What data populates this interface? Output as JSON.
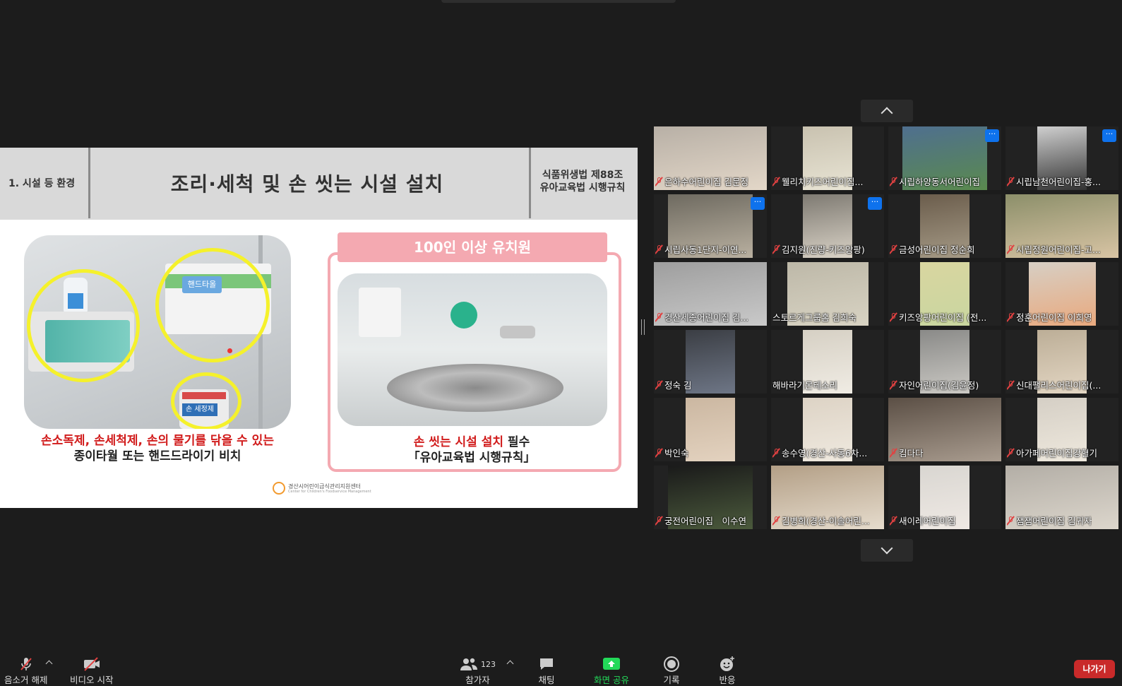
{
  "slide": {
    "header_left": "1. 시설 등 환경",
    "header_title": "조리·세척 및 손 씻는 시설 설치",
    "header_right_line1": "식품위생법 제88조",
    "header_right_line2": "유아교육법 시행규칙",
    "left_photo_labels": {
      "sanitizer": "손 소독제",
      "towel": "핸드타올",
      "detergent": "손 세정제"
    },
    "left_caption_red": "손소독제, 손세척제, 손의 물기를 닦을 수 있는",
    "left_caption_black": "종이타월 또는 핸드드라이기 비치",
    "box_title": "100인 이상 유치원",
    "right_caption_red": "손 씻는 시설 설치",
    "right_caption_red_suffix": " 필수",
    "right_caption_black": "「유아교육법 시행규칙」",
    "logo_text": "경산시어린이급식관리지원센터",
    "logo_sub": "Center for Children's Foodservice Management"
  },
  "gallery": {
    "participants": [
      {
        "name": "은하수어린이집 김문정",
        "muted": true,
        "more": false
      },
      {
        "name": "웰리치키즈어린이집...",
        "muted": true,
        "more": false
      },
      {
        "name": "시립하양동서어린이집",
        "muted": true,
        "more": true
      },
      {
        "name": "시립남천어린이집-홍...",
        "muted": true,
        "more": true
      },
      {
        "name": "시립사동1단지-이연...",
        "muted": true,
        "more": true
      },
      {
        "name": "김지원(진량-키즈앙팡)",
        "muted": true,
        "more": true
      },
      {
        "name": "금성어린이집 정순희",
        "muted": true,
        "more": false
      },
      {
        "name": "시립정원어린이집-고...",
        "muted": true,
        "more": false
      },
      {
        "name": "경산세종어린이집 김...",
        "muted": true,
        "more": false
      },
      {
        "name": "스토르게그룹홈 김희숙",
        "muted": false,
        "more": false
      },
      {
        "name": "키즈앙팡어린이집 (전...",
        "muted": true,
        "more": false
      },
      {
        "name": "정훈어린이집 이희영",
        "muted": true,
        "more": false
      },
      {
        "name": "정숙 김",
        "muted": true,
        "more": false
      },
      {
        "name": "해바라기몬테소리",
        "muted": false,
        "more": false
      },
      {
        "name": "자인어린이집(김윤정)",
        "muted": true,
        "more": false
      },
      {
        "name": "신대팰리스어린이집(...",
        "muted": true,
        "more": false
      },
      {
        "name": "박인숙",
        "muted": true,
        "more": false
      },
      {
        "name": "송수영(경산-사동6차...",
        "muted": true,
        "more": false
      },
      {
        "name": "킴다다",
        "muted": true,
        "more": false
      },
      {
        "name": "아가페어린이집강혈기",
        "muted": true,
        "more": false
      },
      {
        "name": "궁전어린이집　이수연",
        "muted": true,
        "more": false
      },
      {
        "name": "김병희(경산-이솔어린...",
        "muted": true,
        "more": false
      },
      {
        "name": "새이레어린이집",
        "muted": true,
        "more": false
      },
      {
        "name": "잼잼어린이집 김귀자",
        "muted": true,
        "more": false
      }
    ]
  },
  "toolbar": {
    "audio_label": "음소거 해제",
    "video_label": "비디오 시작",
    "participants_label": "참가자",
    "participants_count": "123",
    "chat_label": "채팅",
    "share_label": "화면 공유",
    "record_label": "기록",
    "reactions_label": "반응",
    "leave_label": "나가기"
  },
  "colors": {
    "accent_blue": "#0e72ed",
    "share_green": "#23d959",
    "leave_red": "#c92a2a",
    "muted_red": "#e14141",
    "slide_red_text": "#d11b1b",
    "slide_pink": "#f4a9b1",
    "highlight_yellow": "#f5f12b"
  },
  "icons": [
    "mic-muted-icon",
    "video-off-icon",
    "participants-icon",
    "chat-icon",
    "share-screen-icon",
    "record-icon",
    "reactions-icon",
    "chevron-up-icon",
    "chevron-down-icon",
    "more-icon"
  ]
}
